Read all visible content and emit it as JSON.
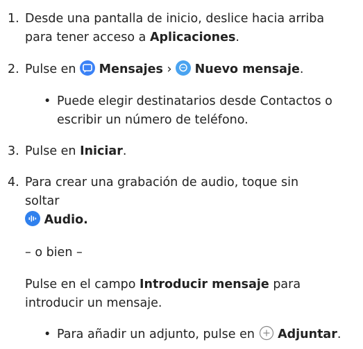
{
  "steps": [
    {
      "number": "1.",
      "line1": "Desde una pantalla de inicio, deslice hacia arriba",
      "line2_prefix": "para tener acceso a ",
      "line2_bold": "Aplicaciones",
      "line2_suffix": "."
    },
    {
      "number": "2.",
      "prefix": "Pulse en ",
      "app_label": "Mensajes",
      "separator": "›",
      "action_label": "Nuevo mensaje",
      "suffix": ".",
      "bullet": {
        "symbol": "•",
        "line1": "Puede elegir destinatarios desde Contactos o",
        "line2": "escribir un número de teléfono."
      }
    },
    {
      "number": "3.",
      "prefix": "Pulse en ",
      "bold": "Iniciar",
      "suffix": "."
    },
    {
      "number": "4.",
      "line1": "Para crear una grabación de audio, toque sin",
      "line2": "soltar",
      "audio_label": "Audio.",
      "alternative": "– o bien –",
      "alt_line1_prefix": "Pulse en el campo ",
      "alt_line1_bold": "Introducir mensaje",
      "alt_line1_suffix": " para",
      "alt_line2": "introducir un mensaje.",
      "bullet": {
        "symbol": "•",
        "prefix": "Para añadir un adjunto, pulse en ",
        "bold": "Adjuntar",
        "suffix": "."
      }
    }
  ],
  "icons": {
    "messages": "chat-bubble-icon",
    "new_message": "new-message-icon",
    "audio": "audio-wave-icon",
    "attach": "plus-circle-icon"
  },
  "colors": {
    "text": "#222222",
    "messages_icon": "#3b82f6",
    "new_message_icon": "#4aa3f0",
    "audio_icon": "#2f80ed",
    "attach_icon": "#888888"
  }
}
